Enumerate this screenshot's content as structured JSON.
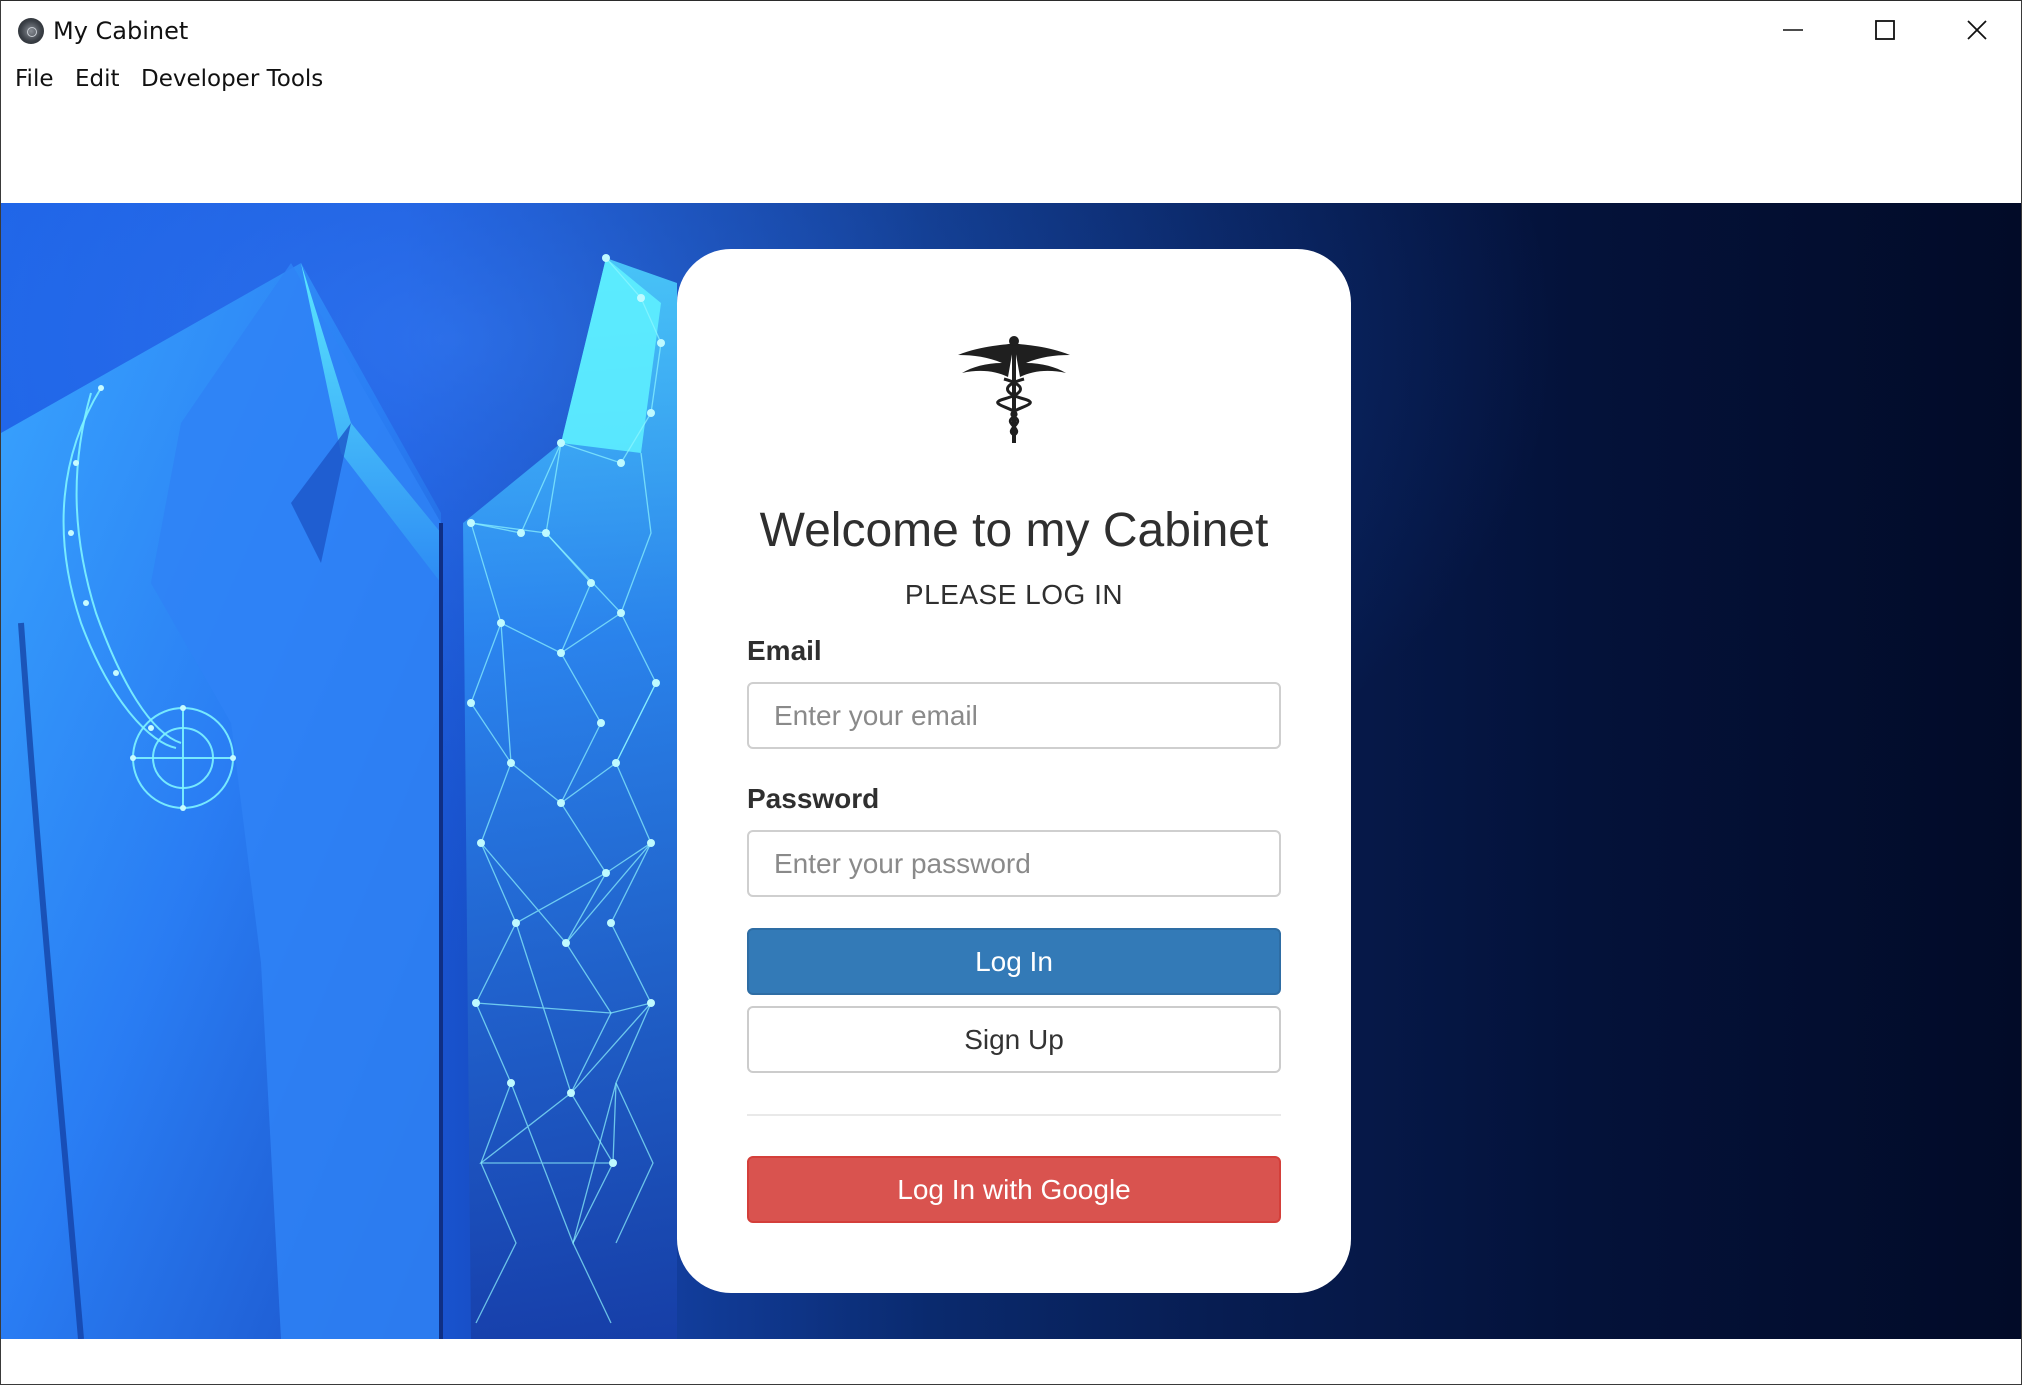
{
  "window": {
    "title": "My Cabinet",
    "controls": {
      "minimize": "minimize-icon",
      "maximize": "maximize-icon",
      "close": "close-icon"
    }
  },
  "menu": {
    "items": [
      "File",
      "Edit",
      "Developer Tools"
    ]
  },
  "login": {
    "logo": "caduceus-icon",
    "heading": "Welcome to my Cabinet",
    "subheading": "PLEASE LOG IN",
    "email_label": "Email",
    "email_placeholder": "Enter your email",
    "email_value": "",
    "password_label": "Password",
    "password_placeholder": "Enter your password",
    "password_value": "",
    "login_button": "Log In",
    "signup_button": "Sign Up",
    "google_button": "Log In with Google"
  },
  "colors": {
    "primary_button": "#337ab7",
    "google_button": "#d9534f",
    "background_blue": "#1b60e4",
    "background_dark": "#020b28",
    "accent_cyan": "#5ff2ff"
  }
}
